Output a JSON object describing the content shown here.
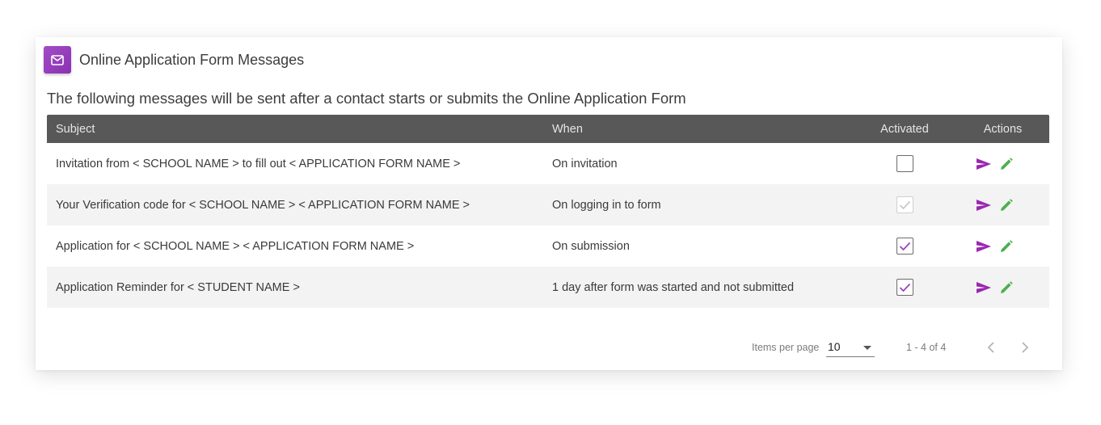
{
  "card": {
    "title": "Online Application Form Messages",
    "icon": "mail-icon",
    "accent_color": "#9b42c0",
    "description": "The following messages will be sent after a contact starts or submits the Online Application Form"
  },
  "table": {
    "headers": {
      "subject": "Subject",
      "when": "When",
      "activated": "Activated",
      "actions": "Actions"
    },
    "rows": [
      {
        "subject": "Invitation from < SCHOOL NAME > to fill out < APPLICATION FORM NAME >",
        "when": "On invitation",
        "activated": false,
        "disabled": false
      },
      {
        "subject": "Your Verification code for < SCHOOL NAME > < APPLICATION FORM NAME >",
        "when": "On logging in to form",
        "activated": true,
        "disabled": true
      },
      {
        "subject": "Application for < SCHOOL NAME > < APPLICATION FORM NAME >",
        "when": "On submission",
        "activated": true,
        "disabled": false
      },
      {
        "subject": "Application Reminder for < STUDENT NAME >",
        "when": "1 day after form was started and not submitted",
        "activated": true,
        "disabled": false
      }
    ],
    "action_icons": {
      "send": "send-icon",
      "edit": "pencil-icon"
    },
    "send_color": "#9b27b0",
    "edit_color": "#4caf50"
  },
  "paginator": {
    "items_per_page_label": "Items per page",
    "items_per_page_value": "10",
    "range_label": "1 - 4 of 4",
    "prev_icon": "chevron-left-icon",
    "next_icon": "chevron-right-icon"
  }
}
